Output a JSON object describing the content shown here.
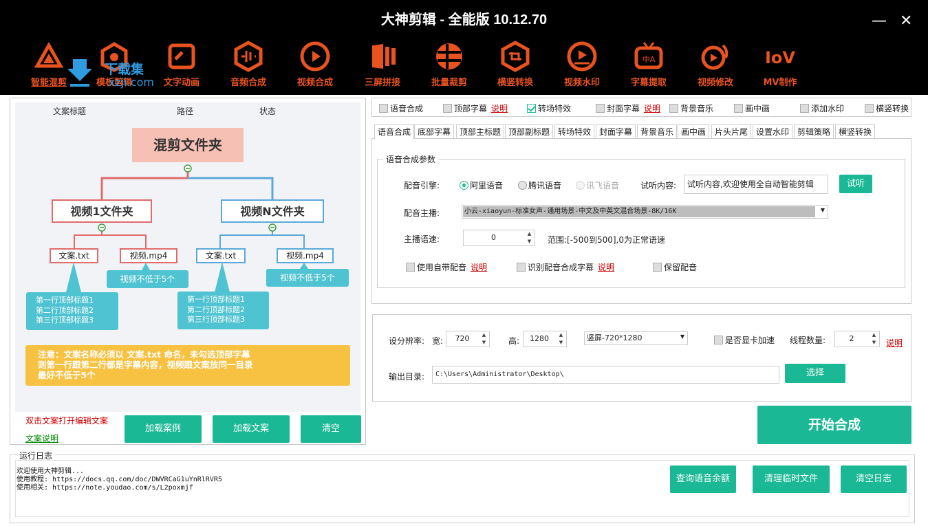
{
  "window": {
    "title": "大神剪辑 - 全能版 10.12.70",
    "minimize": "—",
    "close": "✕"
  },
  "watermark": {
    "text1": "下载集",
    "text2": "xzji.com"
  },
  "nav": [
    {
      "label": "智能混剪",
      "icon": "smart-mix-icon"
    },
    {
      "label": "模板剪辑",
      "icon": "template-edit-icon"
    },
    {
      "label": "文字动画",
      "icon": "text-animation-icon"
    },
    {
      "label": "音频合成",
      "icon": "audio-synthesis-icon"
    },
    {
      "label": "视频合成",
      "icon": "video-synthesis-icon"
    },
    {
      "label": "三屏拼接",
      "icon": "triple-screen-icon"
    },
    {
      "label": "批量裁剪",
      "icon": "batch-crop-icon"
    },
    {
      "label": "横竖转换",
      "icon": "orientation-convert-icon"
    },
    {
      "label": "视频水印",
      "icon": "video-watermark-icon"
    },
    {
      "label": "字幕提取",
      "icon": "subtitle-extract-icon"
    },
    {
      "label": "视频修改",
      "icon": "video-modify-icon"
    },
    {
      "label": "MV制作",
      "icon": "mv-make-icon"
    }
  ],
  "left": {
    "columns": [
      "文案标题",
      "路径",
      "状态"
    ],
    "diagram": {
      "root": "混剪文件夹",
      "folder1": "视频1文件夹",
      "folderN": "视频N文件夹",
      "txt1": "文案.txt",
      "mp41": "视频.mp4",
      "txt2": "文案.txt",
      "mp42": "视频.mp4",
      "note1": "视频不低于5个",
      "note2": "视频不低于5个",
      "titles1": [
        "第一行顶部标题1",
        "第二行顶部标题2",
        "第三行顶部标题3"
      ],
      "titles2": [
        "第一行顶部标题1",
        "第二行顶部标题2",
        "第三行顶部标题3"
      ],
      "warning": [
        "注意：文案名称必须以 文案.txt 命名，未勾选顶部字幕",
        "则第一行跟第二行都是字幕内容，视频跟文案放同一目录",
        "最好不低于5个"
      ]
    },
    "hint_dblclick": "双击文案打开编辑文案",
    "hint_explain": "文案说明",
    "btn_load_case": "加载案例",
    "btn_load_text": "加载文案",
    "btn_clear": "清空"
  },
  "features": [
    {
      "label": "语音合成",
      "checked": false,
      "link": ""
    },
    {
      "label": "顶部字幕",
      "checked": false,
      "link": "说明"
    },
    {
      "label": "转场特效",
      "checked": true,
      "link": ""
    },
    {
      "label": "封面字幕",
      "checked": false,
      "link": "说明"
    },
    {
      "label": "背景音乐",
      "checked": false,
      "link": ""
    },
    {
      "label": "画中画",
      "checked": false,
      "link": ""
    },
    {
      "label": "添加水印",
      "checked": false,
      "link": ""
    },
    {
      "label": "横竖转换",
      "checked": false,
      "link": ""
    }
  ],
  "tabs": [
    "语音合成",
    "底部字幕",
    "顶部主标题",
    "顶部副标题",
    "转场特效",
    "封面字幕",
    "背景音乐",
    "画中画",
    "片头片尾",
    "设置水印",
    "剪辑策略",
    "横竖转换"
  ],
  "voice": {
    "group_title": "语音合成参数",
    "engine_label": "配音引擎:",
    "engines": [
      "阿里语音",
      "腾讯语音",
      "讯飞语音"
    ],
    "preview_label": "试听内容:",
    "preview_value": "试听内容,欢迎使用全自动智能剪辑",
    "preview_btn": "试听",
    "anchor_label": "配音主播:",
    "anchor_value": "小云-xiaoyun-标准女声-通用场景-中文及中英文混合场景-8K/16K",
    "speed_label": "主播语速:",
    "speed_value": "0",
    "speed_range": "范围:[-500到500],0为正常语速",
    "opt_own": "使用自带配音",
    "opt_recog": "识别配音合成字幕",
    "opt_keep": "保留配音",
    "link": "说明"
  },
  "output": {
    "res_label": "设分辨率:",
    "width_label": "宽:",
    "width_value": "720",
    "height_label": "高:",
    "height_value": "1280",
    "preset": "竖屏-720*1280",
    "gpu_label": "是否显卡加速",
    "threads_label": "线程数量:",
    "threads_value": "2",
    "link": "说明",
    "dir_label": "输出目录:",
    "dir_value": "C:\\Users\\Administrator\\Desktop\\",
    "choose_btn": "选择"
  },
  "start_btn": "开始合成",
  "log": {
    "title": "运行日志",
    "lines": [
      "欢迎使用大神剪辑...",
      "使用教程: https://docs.qq.com/doc/DWVRCaG1uYnRlRVR5",
      "使用相关: https://note.youdao.com/s/L2poxmjf"
    ],
    "btn_query": "查询语音余额",
    "btn_clean": "清理临时文件",
    "btn_clear": "清空日志"
  }
}
